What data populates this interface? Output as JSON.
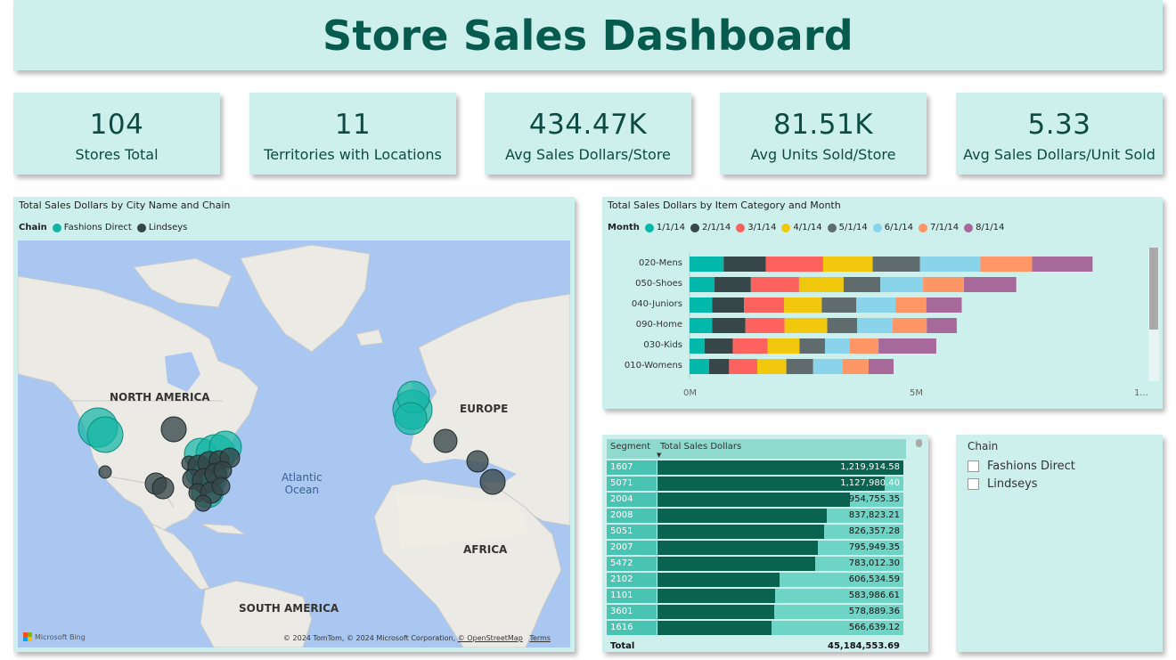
{
  "dashboard": {
    "title": "Store Sales Dashboard"
  },
  "kpis": [
    {
      "value": "104",
      "label": "Stores Total"
    },
    {
      "value": "11",
      "label": "Territories with Locations"
    },
    {
      "value": "434.47K",
      "label": "Avg Sales Dollars/Store"
    },
    {
      "value": "81.51K",
      "label": "Avg Units Sold/Store"
    },
    {
      "value": "5.33",
      "label": "Avg Sales Dollars/Unit Sold"
    }
  ],
  "map_visual": {
    "title": "Total Sales Dollars by City Name and Chain",
    "legend_title": "Chain",
    "legend": [
      {
        "name": "Fashions Direct",
        "color": "#12b5a5"
      },
      {
        "name": "Lindseys",
        "color": "#374649"
      }
    ],
    "labels": {
      "north_america": "NORTH AMERICA",
      "europe": "EUROPE",
      "africa": "AFRICA",
      "south_america": "SOUTH AMERICA",
      "atlantic": "Atlantic",
      "ocean": "Ocean"
    },
    "bing": "Microsoft Bing",
    "attribution_main": "© 2024 TomTom, © 2024 Microsoft Corporation,",
    "attribution_osm": "© OpenStreetMap",
    "attribution_terms": "Terms"
  },
  "bar_visual": {
    "title": "Total Sales Dollars by Item Category and Month",
    "legend_title": "Month",
    "axis_ticks": [
      "0M",
      "5M",
      "1..."
    ]
  },
  "chart_data": {
    "type": "bar",
    "stacked": true,
    "orientation": "horizontal",
    "categories": [
      "020-Mens",
      "050-Shoes",
      "040-Juniors",
      "090-Home",
      "030-Kids",
      "010-Womens"
    ],
    "xlim": [
      0,
      10000000
    ],
    "series": [
      {
        "name": "1/1/14",
        "color": "#01b8aa",
        "values": [
          750000,
          550000,
          500000,
          500000,
          330000,
          430000
        ]
      },
      {
        "name": "2/1/14",
        "color": "#374649",
        "values": [
          930000,
          800000,
          700000,
          730000,
          620000,
          440000
        ]
      },
      {
        "name": "3/1/14",
        "color": "#fd625e",
        "values": [
          1260000,
          1060000,
          880000,
          860000,
          770000,
          620000
        ]
      },
      {
        "name": "4/1/14",
        "color": "#f2c80f",
        "values": [
          1090000,
          980000,
          830000,
          940000,
          700000,
          640000
        ]
      },
      {
        "name": "5/1/14",
        "color": "#5f6b6d",
        "values": [
          1040000,
          810000,
          760000,
          660000,
          560000,
          590000
        ]
      },
      {
        "name": "6/1/14",
        "color": "#8ad4eb",
        "values": [
          1330000,
          940000,
          870000,
          780000,
          550000,
          650000
        ]
      },
      {
        "name": "7/1/14",
        "color": "#fe9666",
        "values": [
          1140000,
          900000,
          670000,
          750000,
          630000,
          570000
        ]
      },
      {
        "name": "8/1/14",
        "color": "#a66999",
        "values": [
          1330000,
          1150000,
          780000,
          660000,
          1270000,
          550000
        ]
      }
    ]
  },
  "table_visual": {
    "col_segment": "Segment",
    "col_sales": "Total Sales Dollars",
    "rows": [
      {
        "segment": "1607",
        "sales": "1,219,914.58",
        "value": 1219914.58
      },
      {
        "segment": "5071",
        "sales": "1,127,980.40",
        "value": 1127980.4
      },
      {
        "segment": "2004",
        "sales": "954,755.35",
        "value": 954755.35
      },
      {
        "segment": "2008",
        "sales": "837,823.21",
        "value": 837823.21
      },
      {
        "segment": "5051",
        "sales": "826,357.28",
        "value": 826357.28
      },
      {
        "segment": "2007",
        "sales": "795,949.35",
        "value": 795949.35
      },
      {
        "segment": "5472",
        "sales": "783,012.30",
        "value": 783012.3
      },
      {
        "segment": "2102",
        "sales": "606,534.59",
        "value": 606534.59
      },
      {
        "segment": "1101",
        "sales": "583,986.61",
        "value": 583986.61
      },
      {
        "segment": "3601",
        "sales": "578,889.36",
        "value": 578889.36
      },
      {
        "segment": "1616",
        "sales": "566,639.12",
        "value": 566639.12
      }
    ],
    "total_label": "Total",
    "total_value": "45,184,553.69"
  },
  "slicer": {
    "title": "Chain",
    "options": [
      "Fashions Direct",
      "Lindseys"
    ]
  }
}
